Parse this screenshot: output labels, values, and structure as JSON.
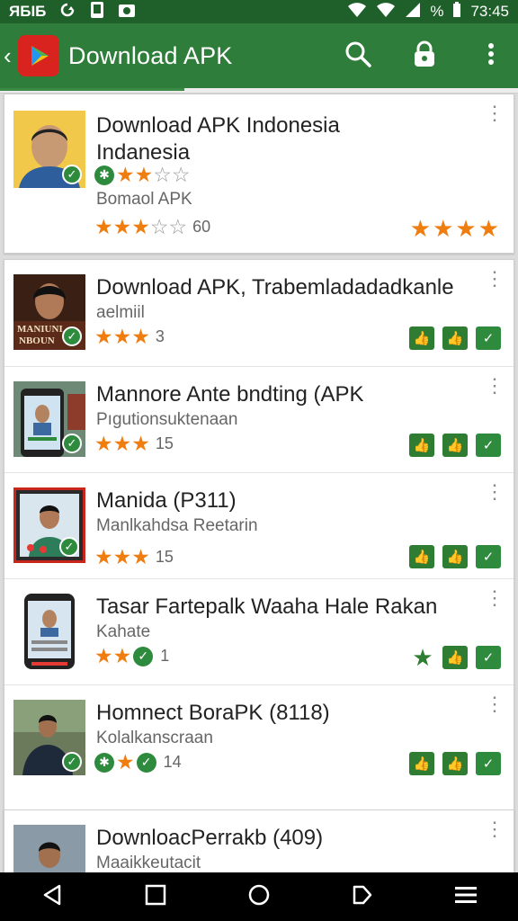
{
  "status": {
    "left_text": "ЯБIБ",
    "battery_percent_icon": "%",
    "time": "73:45"
  },
  "app_bar": {
    "title": "Download APK",
    "back_icon": "chevron-left-icon",
    "logo_icon": "play-logo-icon",
    "actions": [
      "search-icon",
      "lock-icon",
      "more-vertical-icon"
    ]
  },
  "colors": {
    "app_bar": "#2f7d3a",
    "status_bar": "#1f5f2a",
    "star": "#ef7d10",
    "green_action": "#2e7d32"
  },
  "items": [
    {
      "title_line1": "Download APK Indonesia",
      "title_line2": "Indanesia",
      "subtitle": "Bomaol APK",
      "count": "60",
      "top_rating": 2,
      "rating": 3
    },
    {
      "title": "Download APK, Trabemladadadkanle",
      "subtitle": "aelmiil",
      "thumb_text": "MANIUNI NBOUN",
      "count": "3",
      "rating": 3
    },
    {
      "title": "Mannore Ante bndting (APK",
      "subtitle": "Pıgutionsuktenaan",
      "count": "15",
      "rating": 3
    },
    {
      "title": "Manida (P311)",
      "subtitle": "Manlkahdsa Reetarin",
      "count": "15",
      "rating": 3
    },
    {
      "title": "Tasar Fartepalk Waaha Hale Rakan",
      "subtitle": "Kahate",
      "count": "1",
      "rating": 2
    },
    {
      "title": "Homnect BoraPK  (8118)",
      "subtitle": "Kolalkanscraan",
      "count": "14",
      "rating": 1
    },
    {
      "title": "DownloacPerrakb (409)",
      "subtitle": "Maaikkeutacit"
    }
  ],
  "nav": [
    "back-triangle-icon",
    "recents-square-icon",
    "home-circle-icon",
    "bookmark-icon",
    "menu-icon"
  ]
}
